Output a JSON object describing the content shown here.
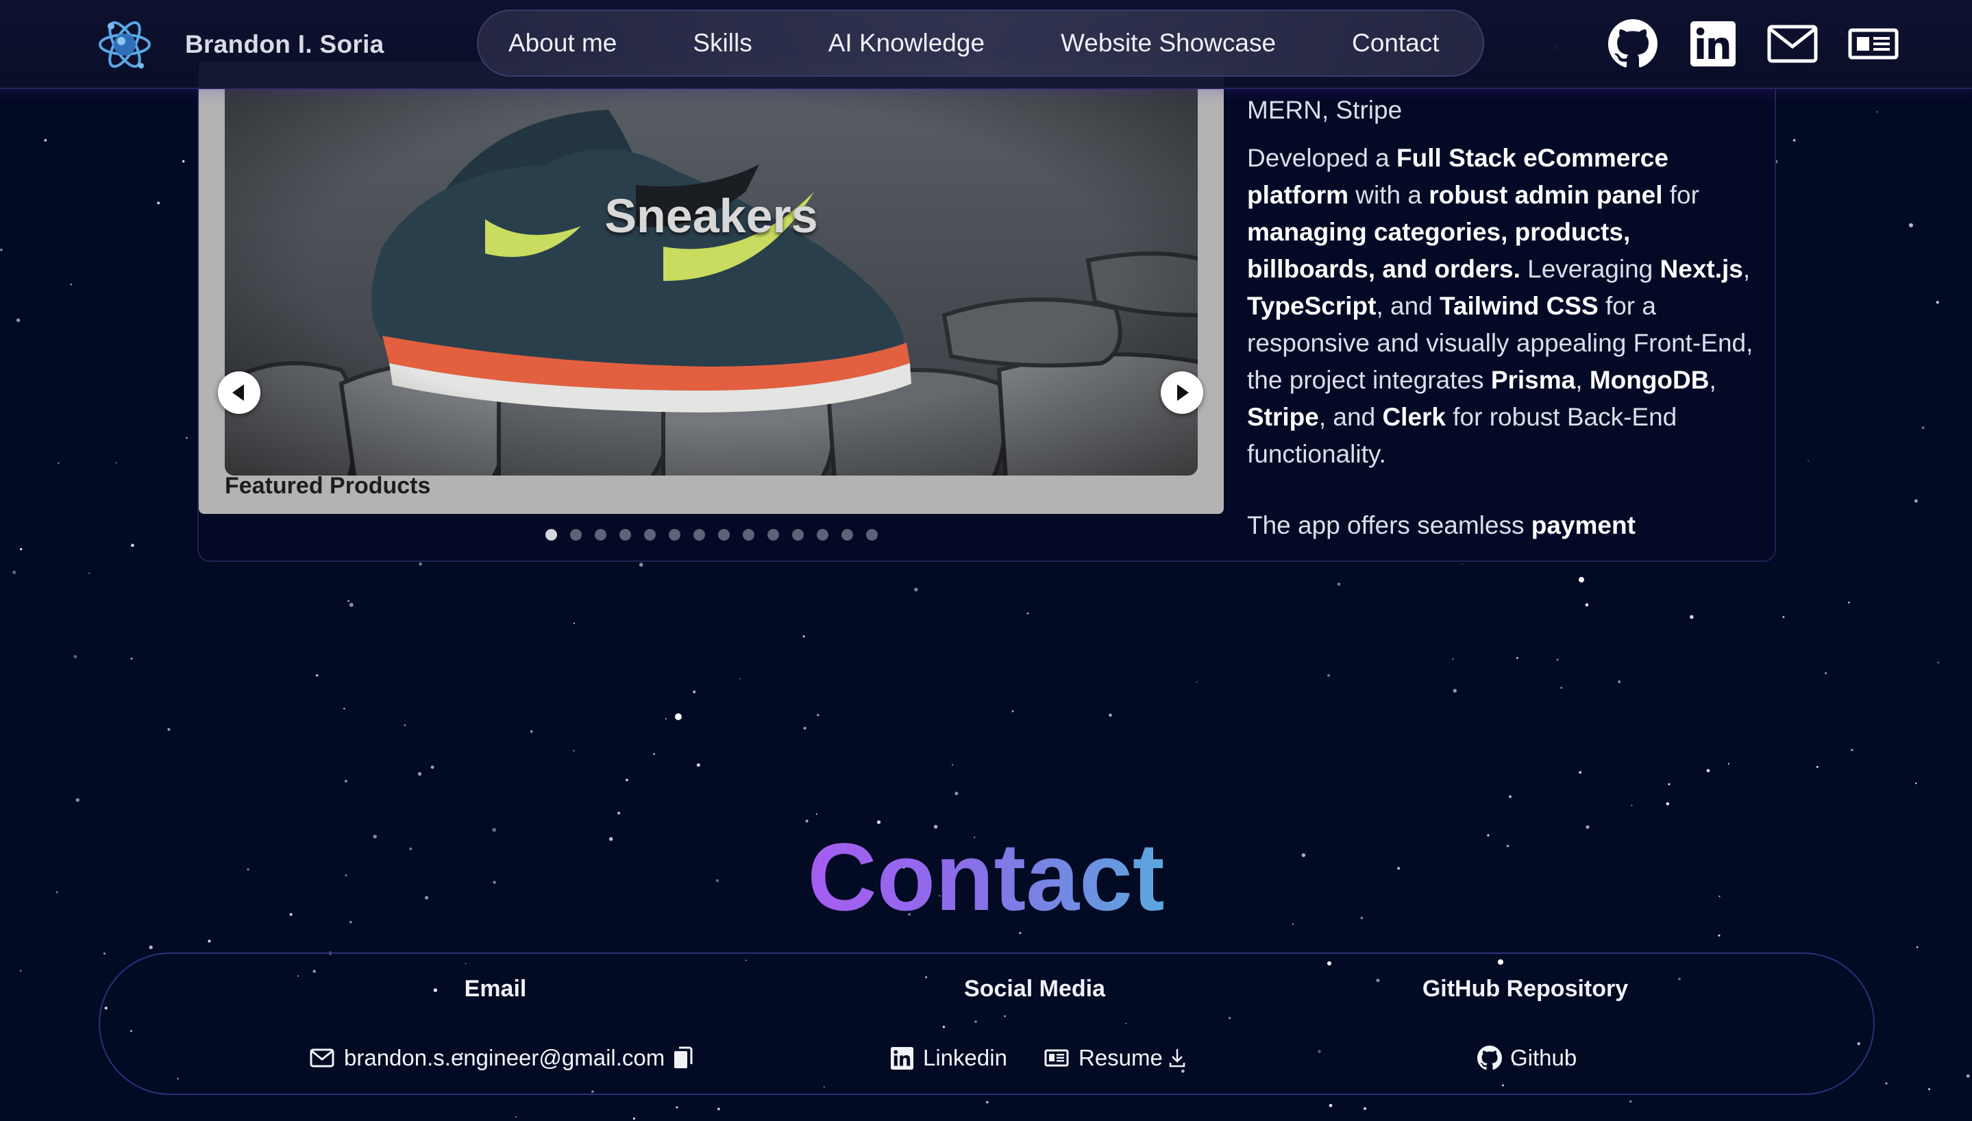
{
  "header": {
    "brand_name": "Brandon I. Soria",
    "logo_icon": "atom-logo-icon",
    "nav": [
      "About me",
      "Skills",
      "AI Knowledge",
      "Website Showcase",
      "Contact"
    ],
    "social_icons": [
      "github-icon",
      "linkedin-icon",
      "mail-icon",
      "resume-card-icon"
    ]
  },
  "project": {
    "slide_title": "Sneakers",
    "caption": "Featured Products",
    "dot_count": 14,
    "active_dot": 0,
    "stack": "MERN, Stripe",
    "description_parts": [
      {
        "t": "Developed a ",
        "b": false
      },
      {
        "t": "Full Stack eCommerce platform",
        "b": true
      },
      {
        "t": " with a ",
        "b": false
      },
      {
        "t": "robust admin panel",
        "b": true
      },
      {
        "t": " for ",
        "b": false
      },
      {
        "t": "managing categories, products, billboards, and orders.",
        "b": true
      },
      {
        "t": " Leveraging ",
        "b": false
      },
      {
        "t": "Next.js",
        "b": true
      },
      {
        "t": ", ",
        "b": false
      },
      {
        "t": "TypeScript",
        "b": true
      },
      {
        "t": ", and ",
        "b": false
      },
      {
        "t": "Tailwind CSS",
        "b": true
      },
      {
        "t": " for a responsive and visually appealing Front-End, the project integrates ",
        "b": false
      },
      {
        "t": "Prisma",
        "b": true
      },
      {
        "t": ", ",
        "b": false
      },
      {
        "t": "MongoDB",
        "b": true
      },
      {
        "t": ", ",
        "b": false
      },
      {
        "t": "Stripe",
        "b": true
      },
      {
        "t": ", and ",
        "b": false
      },
      {
        "t": "Clerk",
        "b": true
      },
      {
        "t": " for robust Back-End functionality.",
        "b": false
      }
    ],
    "description_parts_2": [
      {
        "t": "The app offers seamless ",
        "b": false
      },
      {
        "t": "payment",
        "b": true
      }
    ]
  },
  "contact": {
    "title": "Contact",
    "email_heading": "Email",
    "social_heading": "Social Media",
    "github_heading": "GitHub Repository",
    "email": "brandon.s.engineer@gmail.com",
    "linkedin_label": "Linkedin",
    "resume_label": "Resume",
    "github_label": "Github"
  },
  "colors": {
    "background": "#030a24",
    "accent_purple": "#a65cf2",
    "accent_blue": "#5ba7dd"
  }
}
